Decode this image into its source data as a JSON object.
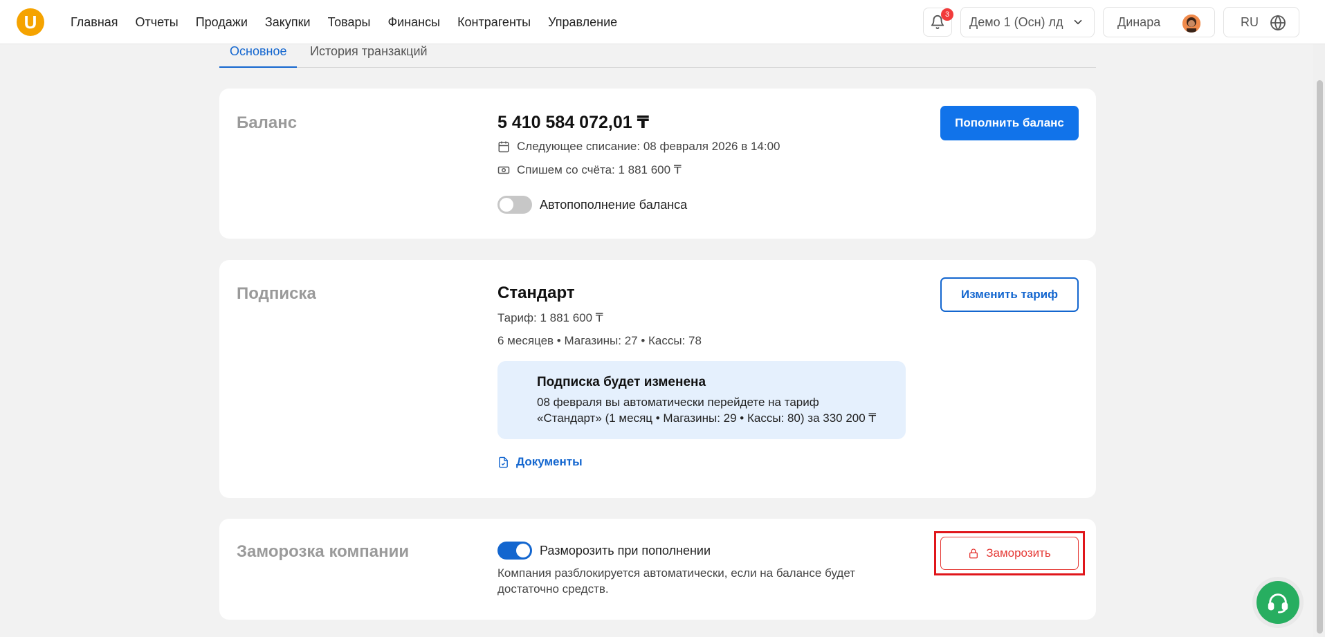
{
  "header": {
    "logo_letter": "U",
    "nav": [
      "Главная",
      "Отчеты",
      "Продажи",
      "Закупки",
      "Товары",
      "Финансы",
      "Контрагенты",
      "Управление"
    ],
    "notifications_count": "3",
    "company": "Демо 1 (Осн) лд",
    "user_name": "Динара",
    "language": "RU"
  },
  "tabs": [
    {
      "label": "Основное",
      "active": true
    },
    {
      "label": "История транзакций",
      "active": false
    }
  ],
  "balance": {
    "title": "Баланс",
    "amount": "5 410 584 072,01 ₸",
    "next_charge": "Следующее списание: 08 февраля 2026 в 14:00",
    "charge_amount": "Спишем со счёта: 1 881 600 ₸",
    "autotopup_label": "Автопополнение баланса",
    "autotopup_enabled": false,
    "topup_button": "Пополнить баланс"
  },
  "subscription": {
    "title": "Подписка",
    "plan_name": "Стандарт",
    "tariff": "Тариф: 1 881 600 ₸",
    "details": "6 месяцев • Магазины: 27 • Кассы: 78",
    "change_button": "Изменить тариф",
    "notice_title": "Подписка будет изменена",
    "notice_line1": "08 февраля вы автоматически перейдете на тариф",
    "notice_line2": "«Стандарт» (1 месяц • Магазины: 29 • Кассы: 80) за 330 200 ₸",
    "documents_link": "Документы"
  },
  "freeze": {
    "title": "Заморозка компании",
    "unfreeze_label": "Разморозить при пополнении",
    "unfreeze_enabled": true,
    "description": "Компания разблокируется автоматически, если на балансе будет достаточно средств.",
    "freeze_button": "Заморозить"
  },
  "colors": {
    "accent": "#1173ea",
    "danger": "#e53935",
    "logo": "#f5a300",
    "support": "#27ae60",
    "notice_bg": "#e5f0fd"
  }
}
